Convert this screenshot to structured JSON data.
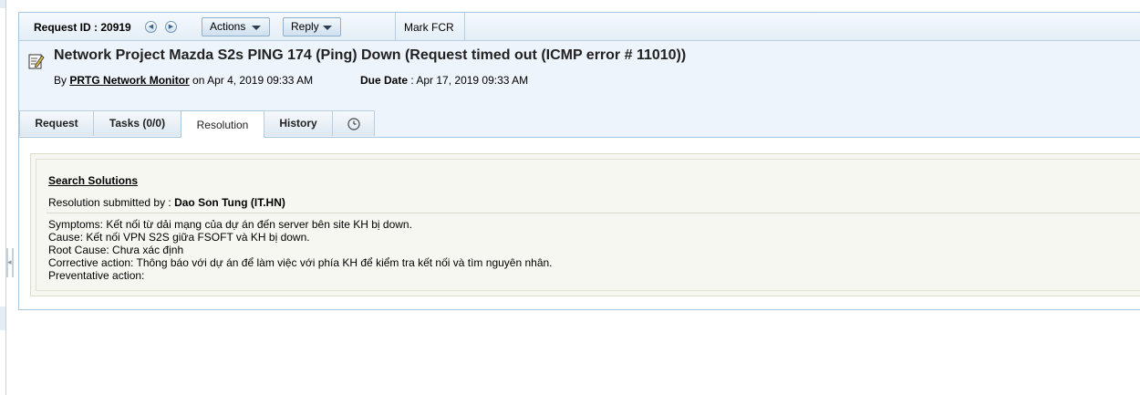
{
  "toolbar": {
    "request_id": "Request ID : 20919",
    "actions_label": "Actions",
    "reply_label": "Reply",
    "mark_fcr_label": "Mark FCR"
  },
  "request": {
    "title": "Network Project Mazda S2s PING 174 (Ping) Down (Request timed out (ICMP error # 11010))",
    "by_prefix": "By",
    "author": "PRTG Network Monitor",
    "on_text": "on  Apr 4, 2019 09:33 AM",
    "due_label": "Due Date",
    "due_value": ": Apr 17, 2019 09:33 AM"
  },
  "tabs": [
    {
      "label": "Request"
    },
    {
      "label": "Tasks (0/0)"
    },
    {
      "label": "Resolution"
    },
    {
      "label": "History"
    }
  ],
  "resolution": {
    "search_solutions_label": "Search Solutions",
    "submitted_prefix": "Resolution submitted by :",
    "submitted_by": "Dao Son Tung (IT.HN)",
    "lines": [
      "Symptoms: Kết nối từ dải mạng của dự án đến server bên site KH bị down.",
      "Cause: Kết nối VPN S2S giữa FSOFT và KH bị down.",
      "Root Cause: Chưa xác định",
      "Corrective action: Thông báo với dự án để làm việc với phía KH để kiểm tra kết nối và tìm nguyên nhân.",
      "Preventative action:"
    ]
  },
  "icons": {
    "prev": "prev-circle-icon",
    "next": "next-circle-icon",
    "document": "edit-document-icon",
    "clock": "clock-icon"
  },
  "colors": {
    "toolbar_bg": "#e4eef7",
    "border": "#a9c5d9",
    "header_bg": "#eef4fb",
    "content_bg": "#f7f7f2"
  }
}
